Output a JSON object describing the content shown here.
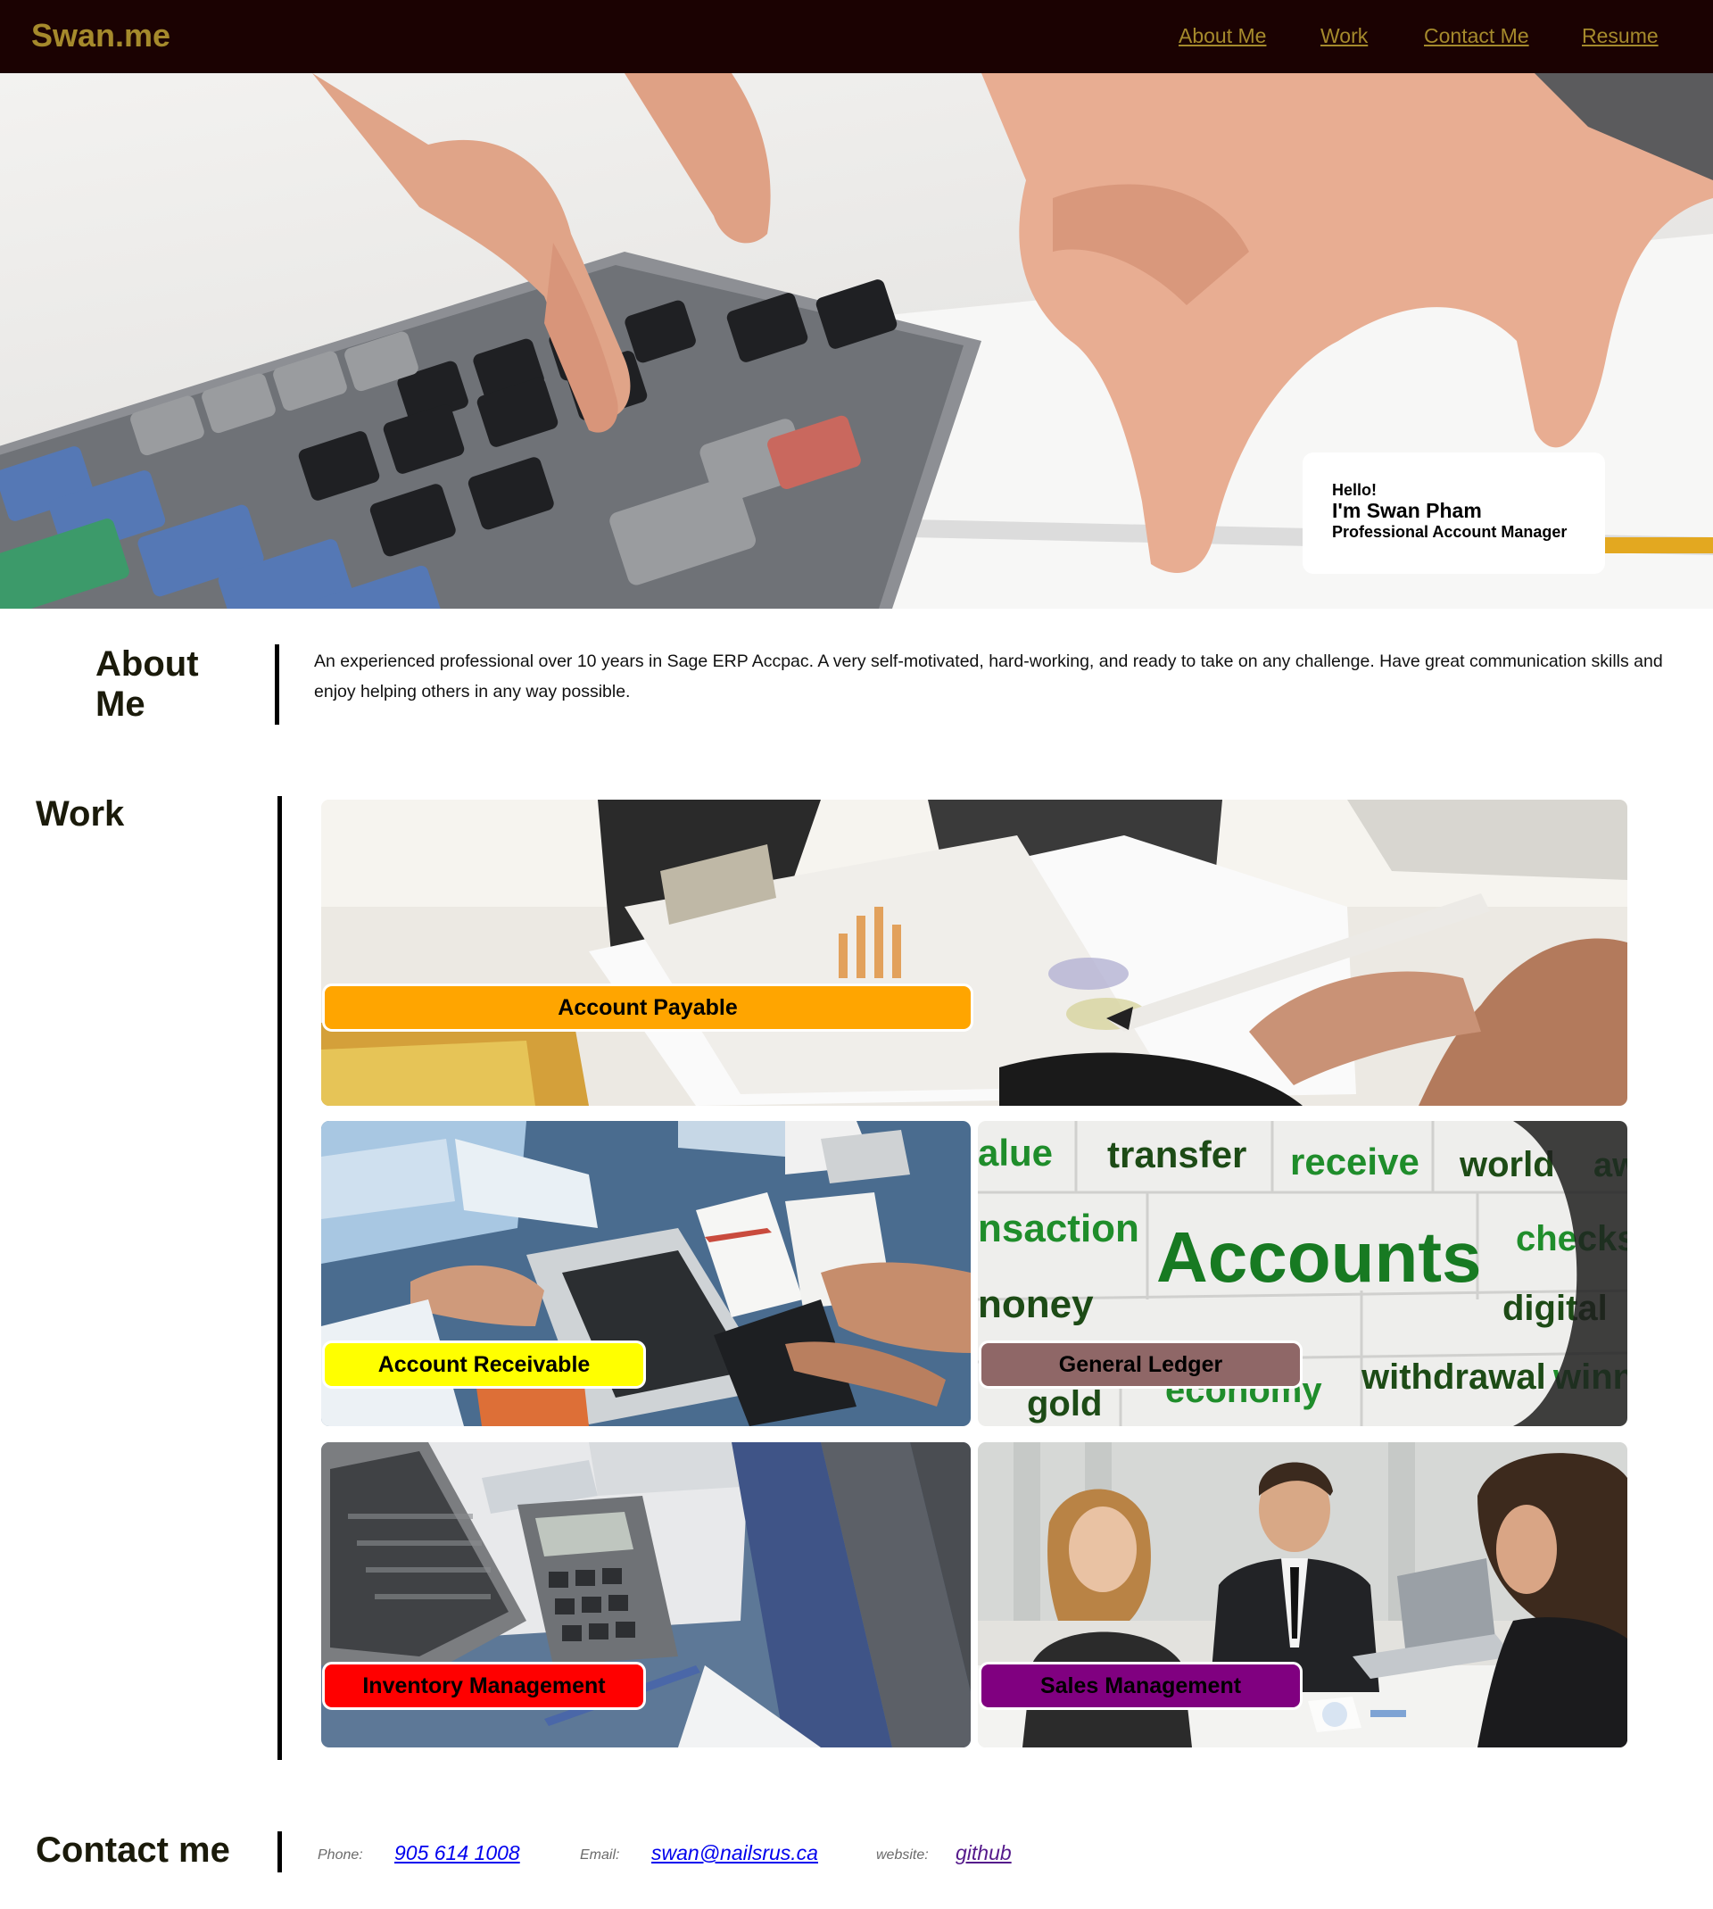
{
  "header": {
    "brand": "Swan.me",
    "nav": [
      "About Me",
      "Work",
      "Contact Me",
      "Resume"
    ]
  },
  "hero": {
    "greeting": "Hello!",
    "name": "I'm Swan Pham",
    "role": "Professional Account Manager"
  },
  "about": {
    "title_line1": "About",
    "title_line2": "Me",
    "text": "An experienced professional over 10 years in Sage ERP Accpac. A very self-motivated, hard-working, and ready to take on any challenge. Have great communication skills and enjoy helping others in any way possible."
  },
  "work": {
    "title": "Work",
    "tiles": [
      {
        "label": "Account Payable",
        "color": "#ffa500"
      },
      {
        "label": "Account Receivable",
        "color": "#ffff00"
      },
      {
        "label": "General Ledger",
        "color": "#8f6767"
      },
      {
        "label": "Inventory Management",
        "color": "#ff0000"
      },
      {
        "label": "Sales Management",
        "color": "#800080"
      }
    ],
    "wordcloud": [
      "alue",
      "transfer",
      "receive",
      "world",
      "awa",
      "nsaction",
      "Accounts",
      "checks",
      "noney",
      "digital",
      "gold",
      "economy",
      "withdrawal",
      "winn"
    ]
  },
  "contact": {
    "title": "Contact me",
    "phone_label": "Phone:",
    "phone": "905 614 1008",
    "email_label": "Email:",
    "email": "swan@nailsrus.ca",
    "website_label": "website:",
    "website": "github"
  },
  "colors": {
    "header_bg": "#1b0202",
    "brand": "#a58a2c",
    "link": "#0000ee",
    "visited_link": "#551a8b"
  }
}
